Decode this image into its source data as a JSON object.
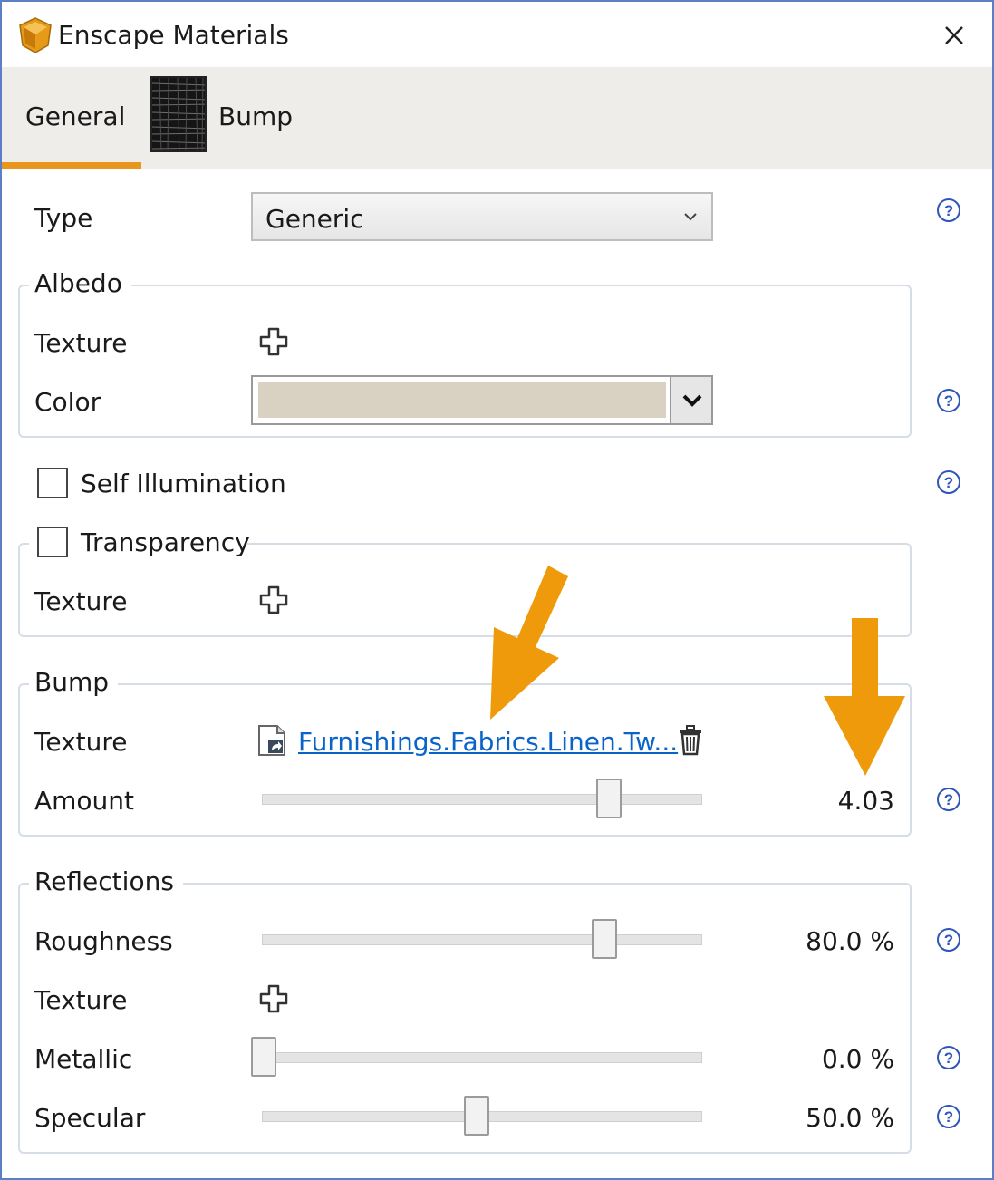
{
  "window": {
    "title": "Enscape Materials"
  },
  "tabs": [
    {
      "label": "General",
      "active": true
    },
    {
      "label": "Bump",
      "active": false
    }
  ],
  "general": {
    "type_label": "Type",
    "type_value": "Generic",
    "albedo": {
      "legend": "Albedo",
      "texture_label": "Texture",
      "color_label": "Color",
      "color_value": "#d9d1c1"
    },
    "self_illumination": {
      "label": "Self Illumination",
      "checked": false
    },
    "transparency": {
      "legend": "Transparency",
      "checked": false,
      "texture_label": "Texture"
    },
    "bump": {
      "legend": "Bump",
      "texture_label": "Texture",
      "texture_file": "Furnishings.Fabrics.Linen.Tw...",
      "amount_label": "Amount",
      "amount_value": "4.03",
      "amount_fraction": 0.81
    },
    "reflections": {
      "legend": "Reflections",
      "roughness_label": "Roughness",
      "roughness_value": "80.0 %",
      "roughness_fraction": 0.8,
      "texture_label": "Texture",
      "metallic_label": "Metallic",
      "metallic_value": "0.0 %",
      "metallic_fraction": 0.0,
      "specular_label": "Specular",
      "specular_value": "50.0 %",
      "specular_fraction": 0.5
    }
  },
  "colors": {
    "accent": "#e8961e",
    "link": "#0a64c8",
    "annotation_arrow": "#ee9a0a"
  },
  "icons": [
    "app-logo-icon",
    "close-icon",
    "chevron-down-icon",
    "plus-icon",
    "help-icon",
    "file-link-icon",
    "trash-icon"
  ]
}
